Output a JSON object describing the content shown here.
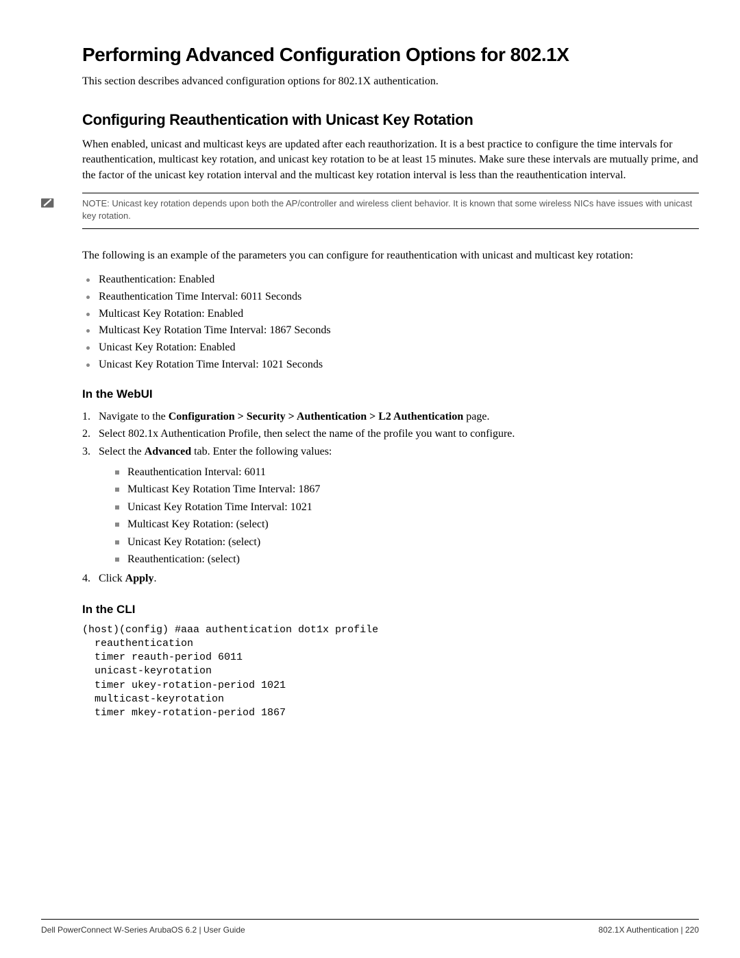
{
  "h1": "Performing Advanced Configuration Options for 802.1X",
  "intro": "This section describes advanced configuration options for 802.1X authentication.",
  "h2": "Configuring Reauthentication with Unicast Key Rotation",
  "para1": "When enabled, unicast and multicast keys are updated after each reauthorization. It is a best practice to configure the time intervals for reauthentication, multicast key rotation, and unicast key rotation to be at least 15 minutes. Make sure these intervals are mutually prime, and the factor of the unicast key rotation interval and the multicast key rotation interval is less than the reauthentication interval.",
  "note": "NOTE: Unicast key rotation depends upon both the AP/controller and wireless client behavior. It is known that some wireless NICs have issues with unicast key rotation.",
  "para2": "The following is an example of the parameters you can configure for reauthentication with unicast and multicast key rotation:",
  "example_params": [
    "Reauthentication: Enabled",
    "Reauthentication Time Interval: 6011 Seconds",
    "Multicast Key Rotation: Enabled",
    "Multicast Key Rotation Time Interval: 1867 Seconds",
    "Unicast Key Rotation: Enabled",
    "Unicast Key Rotation Time Interval: 1021 Seconds"
  ],
  "webui": {
    "heading": "In the WebUI",
    "step1_prefix": "Navigate to the ",
    "step1_bold": "Configuration > Security > Authentication > L2 Authentication",
    "step1_suffix": " page.",
    "step2": "Select 802.1x Authentication Profile, then select the name of the profile you want to configure.",
    "step3_prefix": "Select the ",
    "step3_bold": "Advanced",
    "step3_suffix": " tab. Enter the following values:",
    "step3_items": [
      "Reauthentication Interval: 6011",
      "Multicast Key Rotation Time Interval: 1867",
      "Unicast Key Rotation Time Interval: 1021",
      "Multicast Key Rotation: (select)",
      "Unicast Key Rotation: (select)",
      "Reauthentication: (select)"
    ],
    "step4_prefix": "Click ",
    "step4_bold": "Apply",
    "step4_suffix": "."
  },
  "cli": {
    "heading": "In the CLI",
    "code": "(host)(config) #aaa authentication dot1x profile\n  reauthentication\n  timer reauth-period 6011\n  unicast-keyrotation\n  timer ukey-rotation-period 1021\n  multicast-keyrotation\n  timer mkey-rotation-period 1867"
  },
  "footer": {
    "left": "Dell PowerConnect W-Series ArubaOS 6.2 | User Guide",
    "right": "802.1X Authentication  |  220"
  }
}
